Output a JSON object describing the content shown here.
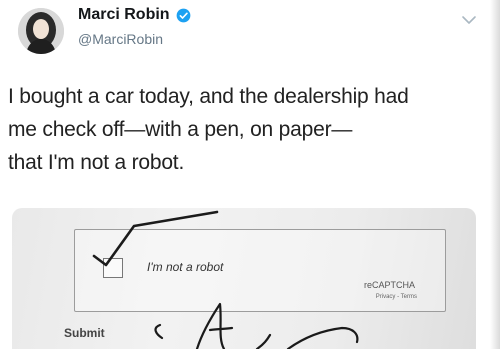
{
  "tweet": {
    "author": {
      "display_name": "Marci Robin",
      "handle": "@MarciRobin",
      "verified": true
    },
    "text": "I bought a car today, and the dealership had\nme check off—with a pen, on paper—\nthat I'm not a robot.",
    "icons": {
      "verified": "verified-badge-icon",
      "menu": "chevron-down-icon"
    },
    "colors": {
      "verified": "#1da1f2",
      "handle": "#657786"
    }
  },
  "photo": {
    "checkbox_label": "I'm not a robot",
    "recaptcha_brand": "reCAPTCHA",
    "recaptcha_links": "Privacy - Terms",
    "submit_label": "Submit",
    "checkbox_checked": true
  }
}
